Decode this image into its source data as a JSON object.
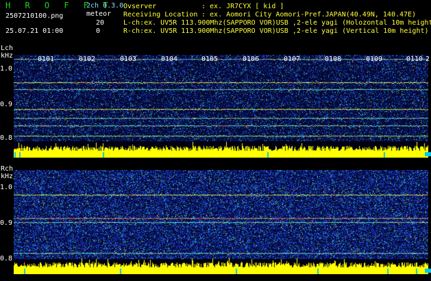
{
  "header": {
    "brand": "H R O F F T",
    "mode": "2ch 0.3.0",
    "filename": "2507210100.png",
    "meteor_label": "meteor",
    "count_top": "20",
    "datetime": "25.07.21 01:00",
    "count_bottom": "0",
    "observer_label": "Ovserver",
    "observer_value": ": ex. JR7CYX [ kid ]",
    "location_label": "Receiving Location",
    "location_value": ": ex. Aomori City Aomori-Pref.JAPAN(40.49N, 140.47E)",
    "lch_info": "L-ch:ex. UV5R 113.900Mhz(SAPPORO VOR)USB ,2-ele yagi (Holozontal 10m height",
    "rch_info": "R-ch:ex. UV5R 113.900Mhz(SAPPORO VOR)USB ,2-ele yagi (Vertical 10m height)"
  },
  "left_channel": {
    "label": "Lch",
    "unit": "kHz",
    "yticks": [
      "1.0",
      "0.9",
      "0.8"
    ],
    "time_ticks": [
      "0101",
      "0102",
      "0103",
      "0104",
      "0105",
      "0106",
      "0107",
      "0108",
      "0109",
      "0110"
    ],
    "edge_label": "2"
  },
  "right_channel": {
    "label": "Rch",
    "unit": "kHz",
    "yticks": [
      "1.0",
      "0.9",
      "0.8"
    ]
  },
  "colors": {
    "background": "#000000",
    "noise_low": "#0a1a7a",
    "noise_mid": "#2a4cff",
    "signal_line": "#ff5050",
    "amplitude": "#ffff00",
    "ruler": "#40d8ff"
  }
}
